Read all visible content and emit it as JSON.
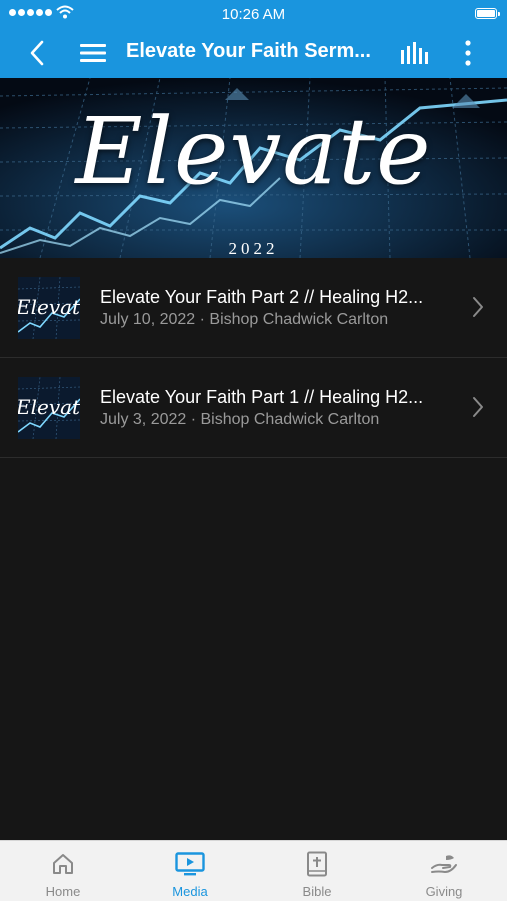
{
  "status_bar": {
    "time": "10:26 AM"
  },
  "nav": {
    "title": "Elevate Your Faith Serm..."
  },
  "banner": {
    "title": "Elevate",
    "year": "2022"
  },
  "sermons": [
    {
      "title": "Elevate Your Faith Part 2 // Healing H2...",
      "subtitle": "July 10, 2022 · Bishop Chadwick Carlton",
      "thumb_text": "Elevate"
    },
    {
      "title": "Elevate Your Faith Part 1 // Healing H2...",
      "subtitle": "July 3, 2022 · Bishop Chadwick Carlton",
      "thumb_text": "Elevate"
    }
  ],
  "tabs": [
    {
      "label": "Home",
      "icon": "home-icon"
    },
    {
      "label": "Media",
      "icon": "media-icon",
      "active": true
    },
    {
      "label": "Bible",
      "icon": "bible-icon"
    },
    {
      "label": "Giving",
      "icon": "giving-icon"
    }
  ],
  "colors": {
    "accent": "#1a95de",
    "background": "#161616",
    "tabbar": "#f2f2f2"
  }
}
